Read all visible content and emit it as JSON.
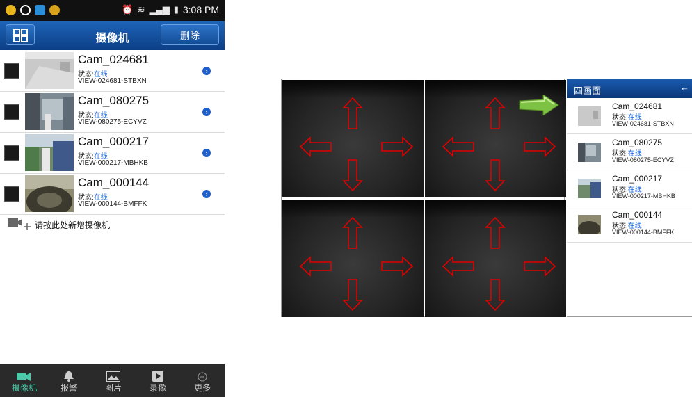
{
  "phone": {
    "status_bar": {
      "time": "3:08 PM",
      "icons": [
        "notification-icon",
        "voicemail-icon",
        "app-icon",
        "app-icon-2"
      ]
    },
    "app_bar": {
      "title": "摄像机",
      "delete_label": "删除"
    },
    "cameras": [
      {
        "name": "Cam_024681",
        "status_label": "状态:",
        "status_value": "在线",
        "id": "VIEW-024681-STBXN"
      },
      {
        "name": "Cam_080275",
        "status_label": "状态:",
        "status_value": "在线",
        "id": "VIEW-080275-ECYVZ"
      },
      {
        "name": "Cam_000217",
        "status_label": "状态:",
        "status_value": "在线",
        "id": "VIEW-000217-MBHKB"
      },
      {
        "name": "Cam_000144",
        "status_label": "状态:",
        "status_value": "在线",
        "id": "VIEW-000144-BMFFK"
      }
    ],
    "add_camera_label": "请按此处新增摄像机",
    "tabs": [
      {
        "label": "摄像机",
        "icon": "camera-icon",
        "active": true
      },
      {
        "label": "报警",
        "icon": "bell-icon",
        "active": false
      },
      {
        "label": "图片",
        "icon": "picture-icon",
        "active": false
      },
      {
        "label": "录像",
        "icon": "video-icon",
        "active": false
      },
      {
        "label": "更多",
        "icon": "more-icon",
        "active": false
      }
    ],
    "colors": {
      "app_bar": "#0c3f86",
      "online": "#1565d8",
      "active_tab": "#4cc9a8"
    }
  },
  "tablet": {
    "panel_title": "四画面",
    "cameras": [
      {
        "name": "Cam_024681",
        "status_label": "状态:",
        "status_value": "在线",
        "id": "VIEW-024681-STBXN"
      },
      {
        "name": "Cam_080275",
        "status_label": "状态:",
        "status_value": "在线",
        "id": "VIEW-080275-ECYVZ"
      },
      {
        "name": "Cam_000217",
        "status_label": "状态:",
        "status_value": "在线",
        "id": "VIEW-000217-MBHKB"
      },
      {
        "name": "Cam_000144",
        "status_label": "状态:",
        "status_value": "在线",
        "id": "VIEW-000144-BMFFK"
      }
    ],
    "colors": {
      "arrow_outline": "#e00000",
      "drag_arrow": "#7dc242"
    }
  }
}
